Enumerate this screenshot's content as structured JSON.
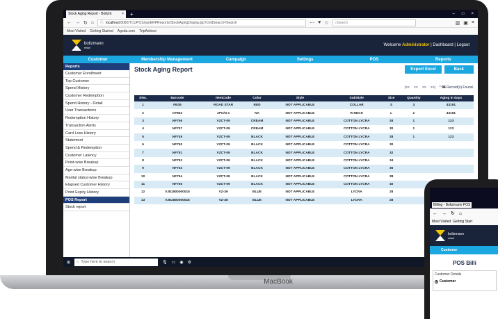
{
  "browser": {
    "tab_title": "Stock Aging Report - Boltzm",
    "tab_close": "×",
    "new_tab": "+",
    "win_min": "–",
    "win_max": "□",
    "win_close": "×",
    "url_host": "localhost",
    "url_rest": ":8080/TCUPOS/jsp/ERPReports/StockAgingDisplay.jsp?cmdSearch=Search",
    "search_placeholder": "Search",
    "bookmarks": [
      "Most Visited",
      "Getting Started",
      "Agoda.com",
      "TripAdvisor"
    ]
  },
  "app": {
    "logo_name": "boltzmann",
    "logo_sub": "retail",
    "welcome_prefix": "Welcome",
    "admin": "Administrator",
    "dashboard": "Dashboard",
    "logout": "Logout",
    "sep": "|"
  },
  "menu": [
    "Customer",
    "Membership Management",
    "Campaign",
    "Settings",
    "POS",
    "Reports"
  ],
  "sidebar": {
    "header": "Reports",
    "items": [
      "Customer Enrollment",
      "Top Customer",
      "Spend History",
      "Customer Redemption",
      "Spend History - Detail",
      "User Transactions",
      "Redemption History",
      "Transaction Alerts",
      "Card Loss History",
      "Statement",
      "Spend & Redemption",
      "Customer Latency",
      "Point-wise Breakup",
      "Age-wise Breakup",
      "Marital status-wise Breakup",
      "Elapsed Customer History",
      "Point Expiry History"
    ],
    "active": "POS Report",
    "last": "Stock report"
  },
  "report": {
    "title": "Stock Aging Report",
    "export_label": "Export Excel",
    "back_label": "Back",
    "pager_first": "|<<",
    "pager_prev": "<<",
    "pager_next": ">>",
    "pager_last": ">>|",
    "records_prefix": "*",
    "record_count": "94",
    "records_suffix": "Record(s) Found.",
    "columns": [
      "SNo.",
      "Barcode",
      "ItemCode",
      "Color",
      "Style",
      "SubStyle",
      "Size",
      "Quantity",
      "Aging in days"
    ],
    "rows": [
      [
        "1",
        "FB35",
        "ROAD STAR",
        "RED",
        "NOT APPLICABLE",
        "COLLAR",
        "S",
        "3",
        "43191"
      ],
      [
        "2",
        "CF853",
        "JPC/N-1",
        "NA",
        "NOT APPLICABLE",
        "R-NECK",
        "L",
        "2",
        "43191"
      ],
      [
        "3",
        "NF756",
        "VZCT-09",
        "CREAM",
        "NOT APPLICABLE",
        "COTTON LYCRA",
        "28",
        "1",
        "123"
      ],
      [
        "4",
        "NF757",
        "VZCT-09",
        "CREAM",
        "NOT APPLICABLE",
        "COTTON LYCRA",
        "30",
        "1",
        "123"
      ],
      [
        "5",
        "NF749",
        "VZCT-09",
        "BLACK",
        "NOT APPLICABLE",
        "COTTON LYCRA",
        "28",
        "1",
        "123"
      ],
      [
        "6",
        "NF750",
        "VZCT-09",
        "BLACK",
        "NOT APPLICABLE",
        "COTTON LYCRA",
        "30",
        "",
        ""
      ],
      [
        "7",
        "NF751",
        "VZCT-09",
        "BLACK",
        "NOT APPLICABLE",
        "COTTON LYCRA",
        "32",
        "",
        ""
      ],
      [
        "8",
        "NF752",
        "VZCT-09",
        "BLACK",
        "NOT APPLICABLE",
        "COTTON LYCRA",
        "34",
        "",
        ""
      ],
      [
        "9",
        "NF753",
        "VZCT-09",
        "BLACK",
        "NOT APPLICABLE",
        "COTTON LYCRA",
        "36",
        "",
        ""
      ],
      [
        "10",
        "NF754",
        "VZCT-09",
        "BLACK",
        "NOT APPLICABLE",
        "COTTON LYCRA",
        "38",
        "",
        ""
      ],
      [
        "11",
        "NF755",
        "VZCT-09",
        "BLACK",
        "NOT APPLICABLE",
        "COTTON LYCRA",
        "40",
        "",
        ""
      ],
      [
        "12",
        "VJE2800000015",
        "VZ-39",
        "BLUE",
        "NOT APPLICABLE",
        "LYCRA",
        "28",
        "",
        ""
      ],
      [
        "13",
        "VJE2800000016",
        "VZ-38",
        "BLUE",
        "NOT APPLICABLE",
        "LYCRA",
        "28",
        "",
        ""
      ]
    ]
  },
  "taskbar": {
    "search_placeholder": "Type here to search"
  },
  "laptop_label": "MacBook",
  "phone": {
    "tab_title": "Billing - Boltzmann POS",
    "bookmark1": "Most Visited",
    "bookmark2": "Getting Start",
    "logo_name": "boltzmann",
    "logo_sub": "retail",
    "menu_item": "Customer",
    "title": "POS Billi",
    "fieldset_legend": "Customer Details",
    "radio_label": "Customer"
  }
}
